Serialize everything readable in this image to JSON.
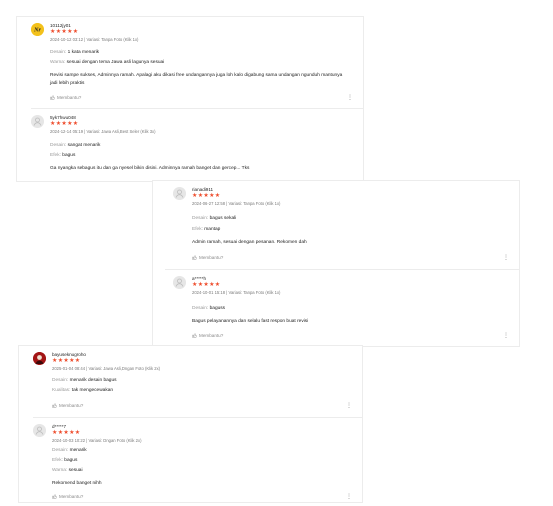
{
  "helpful_label": "Membantu?",
  "more_glyph": "⋮",
  "colors": {
    "star": "#ee4d2d",
    "label": "#9a9a9a",
    "meta": "#7a7a7a"
  },
  "reviews": [
    {
      "username": "10112jy01",
      "rating": 5,
      "meta": "2024-10-12 03:12 | Variasi: Tanpa Foto (Klik 1x)",
      "attributes": [
        {
          "label": "Desain:",
          "value": "1 kata menarik"
        },
        {
          "label": "Warna:",
          "value": "sesuai dengan tema  Jawa asli lagunya sesuai"
        }
      ],
      "comment": "Revisi sampe sukses, Adminnya ramah. Apalagi aku dikasi free undangannya juga loh kalo digabung sama undangan ngunduh mantunya jadi lebih praktis"
    },
    {
      "username": "5yk7hwu048",
      "rating": 5,
      "meta": "2024-12-14 05:19 | Variasi: Jawa Asli,Best Seler (Klik 3x)",
      "attributes": [
        {
          "label": "Desain:",
          "value": "sangat menarik"
        },
        {
          "label": "Efek:",
          "value": "bagus"
        }
      ],
      "comment": "Ga nyangka sebagus itu dan ga nyesel bikin disini. Adminnya ramah banget dan gercep... Tks"
    },
    {
      "username": "rianadi911",
      "rating": 5,
      "meta": "2024-06-27 12:58 | Variasi: Tanpa Foto (Klik 1x)",
      "attributes": [
        {
          "label": "Desain:",
          "value": "bagus sekali"
        },
        {
          "label": "Efek:",
          "value": "mantap"
        }
      ],
      "comment": "Admin ramah, sesuai dengan pesanan. Rekomen dah"
    },
    {
      "username": "a*****h",
      "rating": 5,
      "meta": "2024-10-01 15:18 | Variasi: Tanpa Foto (Klik 1x)",
      "attributes": [
        {
          "label": "Desain:",
          "value": "baguss"
        }
      ],
      "comment": "Bagus pelayanannya dan selalu fast respon buat revisi"
    },
    {
      "username": "bayuseknugroho",
      "rating": 5,
      "meta": "2025-01-04 08:44 | Variasi: Jawa Asli,Dngan Foto (Klik 2x)",
      "attributes": [
        {
          "label": "Desain:",
          "value": "menarik desain bagus"
        },
        {
          "label": "Kualitas:",
          "value": "tak mengecewakan"
        }
      ],
      "comment": ""
    },
    {
      "username": "d*****7",
      "rating": 5,
      "meta": "2024-10-03 10:22 | Variasi: Dngan Foto (Klik 2x)",
      "attributes": [
        {
          "label": "Desain:",
          "value": "menarik"
        },
        {
          "label": "Efek:",
          "value": "bagus"
        },
        {
          "label": "Warna:",
          "value": "sesuai"
        }
      ],
      "comment": "Rekomend banget nihh"
    }
  ]
}
